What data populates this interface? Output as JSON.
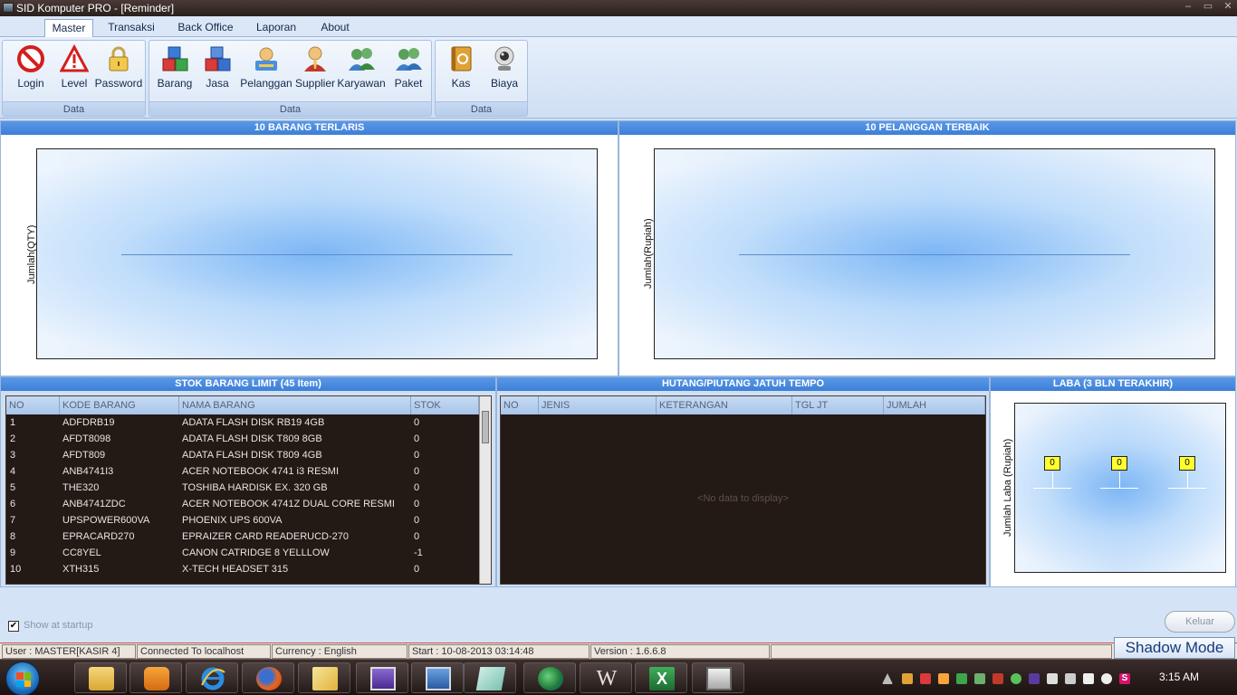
{
  "window": {
    "title": "SID Komputer PRO - [Reminder]"
  },
  "ribbon": {
    "tabs": [
      "Master",
      "Transaksi",
      "Back Office",
      "Laporan",
      "About"
    ],
    "active_tab": "Master",
    "groups": [
      {
        "label": "Data",
        "buttons": [
          "Login",
          "Level",
          "Password"
        ]
      },
      {
        "label": "Data",
        "buttons": [
          "Barang",
          "Jasa",
          "Pelanggan",
          "Supplier",
          "Karyawan",
          "Paket"
        ]
      },
      {
        "label": "Data",
        "buttons": [
          "Kas",
          "Biaya"
        ]
      }
    ]
  },
  "chart_data": [
    {
      "type": "bar",
      "title": "10 BARANG TERLARIS",
      "ylabel": "Jumlah(QTY)",
      "xlabel": "",
      "categories": [],
      "values": []
    },
    {
      "type": "bar",
      "title": "10 PELANGGAN TERBAIK",
      "ylabel": "Jumlah(Rupiah)",
      "xlabel": "",
      "categories": [],
      "values": []
    },
    {
      "type": "bar",
      "title": "LABA (3 BLN TERAKHIR)",
      "ylabel": "Jumlah Laba (Rupiah)",
      "xlabel": "",
      "categories": [
        "",
        "",
        ""
      ],
      "values": [
        0,
        0,
        0
      ],
      "data_labels": [
        "0",
        "0",
        "0"
      ]
    }
  ],
  "stok": {
    "title": "STOK BARANG LIMIT (45 Item)",
    "columns": [
      "NO",
      "KODE BARANG",
      "NAMA BARANG",
      "STOK"
    ],
    "rows": [
      [
        "1",
        "ADFDRB19",
        "ADATA FLASH DISK RB19 4GB",
        "0"
      ],
      [
        "2",
        "AFDT8098",
        "ADATA FLASH DISK T809 8GB",
        "0"
      ],
      [
        "3",
        "AFDT809",
        "ADATA FLASH DISK T809 4GB",
        "0"
      ],
      [
        "4",
        "ANB4741I3",
        "ACER NOTEBOOK 4741 i3 RESMI",
        "0"
      ],
      [
        "5",
        "THE320",
        "TOSHIBA HARDISK EX. 320 GB",
        "0"
      ],
      [
        "6",
        "ANB4741ZDC",
        "ACER NOTEBOOK 4741Z DUAL CORE RESMI",
        "0"
      ],
      [
        "7",
        "UPSPOWER600VA",
        "PHOENIX UPS  600VA",
        "0"
      ],
      [
        "8",
        "EPRACARD270",
        "EPRAIZER CARD READERUCD-270",
        "0"
      ],
      [
        "9",
        "CC8YEL",
        "CANON CATRIDGE 8 YELLLOW",
        "-1"
      ],
      [
        "10",
        "XTH315",
        "X-TECH HEADSET 315",
        "0"
      ]
    ]
  },
  "hutang": {
    "title": "HUTANG/PIUTANG JATUH TEMPO",
    "columns": [
      "NO",
      "JENIS",
      "KETERANGAN",
      "TGL JT",
      "JUMLAH"
    ],
    "empty_text": "<No data to display>"
  },
  "laba": {
    "title": "LABA (3 BLN TERAKHIR)",
    "ylabel": "Jumlah Laba (Rupiah)",
    "values": [
      "0",
      "0",
      "0"
    ]
  },
  "footer": {
    "show_at_startup": "Show at startup",
    "keluar": "Keluar"
  },
  "status": {
    "user": "User : MASTER[KASIR 4]",
    "connection": "Connected To localhost",
    "currency": "Currency : English",
    "start": "Start  : 10-08-2013 03:14:48",
    "version": "Version : 1.6.6.8"
  },
  "shadow_mode": "Shadow Mode",
  "taskbar": {
    "clock": "3:15 AM",
    "apps": [
      "explorer",
      "media-player",
      "internet-explorer",
      "firefox",
      "editor",
      "presentation",
      "window-manager",
      "note",
      "globe",
      "word-document",
      "excel",
      "monitor"
    ]
  },
  "colors": {
    "panel_header": "#3d7fd8",
    "grid_bg": "#231915",
    "marker": "#ffff30"
  }
}
